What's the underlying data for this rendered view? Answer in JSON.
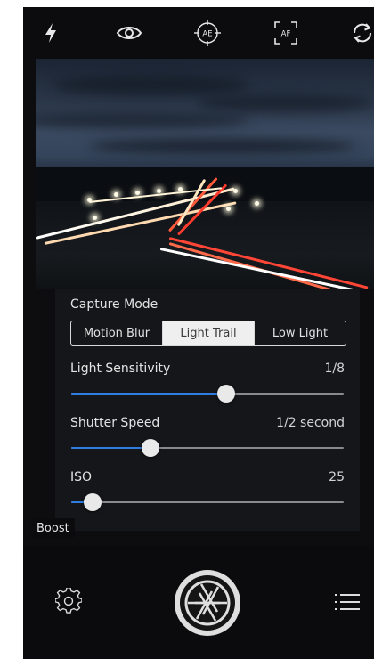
{
  "toolbar": {
    "icons": [
      "flash-icon",
      "eye-icon",
      "ae-lock-icon",
      "af-lock-icon",
      "switch-camera-icon"
    ],
    "ae_label": "AE",
    "af_label": "AF"
  },
  "capture": {
    "title": "Capture Mode",
    "modes": [
      {
        "label": "Motion Blur",
        "active": false
      },
      {
        "label": "Light Trail",
        "active": true
      },
      {
        "label": "Low Light",
        "active": false
      }
    ]
  },
  "settings": {
    "sensitivity": {
      "label": "Light Sensitivity",
      "value": "1/8",
      "level": 0.57
    },
    "shutter": {
      "label": "Shutter Speed",
      "value": "1/2 second",
      "level": 0.29
    },
    "iso": {
      "label": "ISO",
      "value": "25",
      "level": 0.08
    }
  },
  "boost": {
    "label": "Boost"
  },
  "colors": {
    "accent": "#2f7de1"
  }
}
